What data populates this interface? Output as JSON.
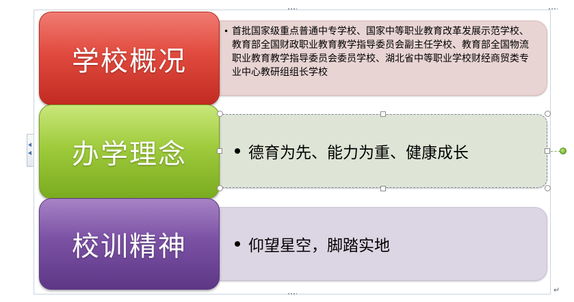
{
  "blocks": [
    {
      "label": "学校概况",
      "color": "#d9403a",
      "text": "首批国家级重点普通中专学校、国家中等职业教育改革发展示范学校、教育部全国财政职业教育教学指导委员会副主任学校、教育部全国物流职业教育教学指导委员会委员学校、湖北省中等职业学校财经商贸类专业中心教研组组长学校"
    },
    {
      "label": "办学理念",
      "color": "#8fc13a",
      "text": "德育为先、能力为重、健康成长"
    },
    {
      "label": "校训精神",
      "color": "#7049a0",
      "text": "仰望星空，脚踏实地"
    }
  ],
  "icons": {
    "bullet": "bullet-dot-icon",
    "rotate": "rotate-handle-icon",
    "expand": "text-pane-toggle-icon",
    "paragraph": "paragraph-mark-icon"
  },
  "marks": {
    "paragraph": "↵"
  }
}
